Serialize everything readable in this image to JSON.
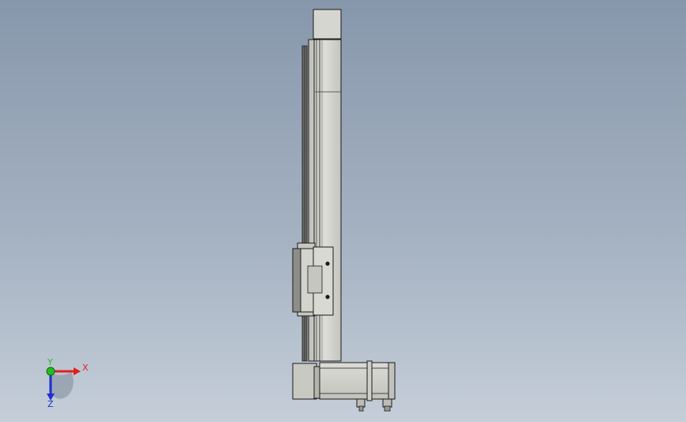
{
  "viewport": {
    "background_top": "#8797ab",
    "background_bottom": "#c5ced9"
  },
  "model": {
    "part_fill": "#cfcfc9",
    "part_shade": "#a9a9a3",
    "edge_color": "#1a1a1a",
    "dark_fill": "#4a4a4a"
  },
  "triad": {
    "x_label": "X",
    "y_label": "Y",
    "z_label": "Z",
    "x_color": "#e02020",
    "y_color": "#20c020",
    "z_color": "#2030d0"
  }
}
